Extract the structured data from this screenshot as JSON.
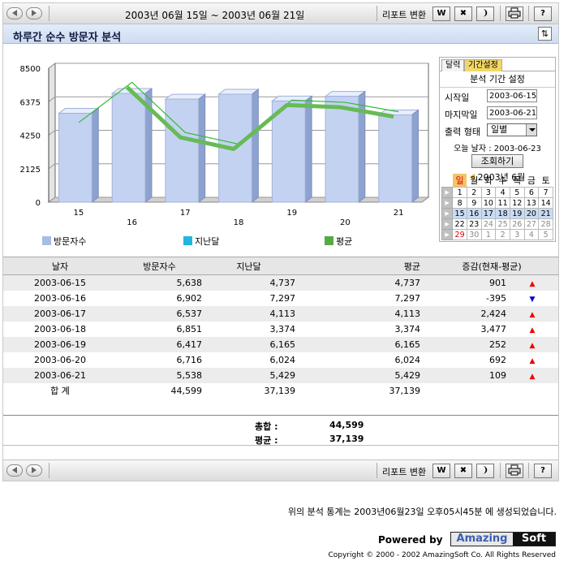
{
  "toolbar": {
    "date_range": "2003년 06월 15일 ~ 2003년 06월 21일",
    "report_label": "리포트 변환",
    "word_icon": "W",
    "excel_icon": "✖",
    "hwp_icon": "❩",
    "print_icon": "printer-icon",
    "help_icon": "?"
  },
  "title": "하루간 순수 방문자 분석",
  "chart_data": {
    "type": "bar",
    "categories": [
      "15",
      "16",
      "17",
      "18",
      "19",
      "20",
      "21"
    ],
    "series": [
      {
        "name": "방문자수",
        "type": "bar",
        "values": [
          5638,
          6902,
          6537,
          6851,
          6417,
          6716,
          5538
        ],
        "color": "#c4d2f2"
      },
      {
        "name": "지난달",
        "type": "line",
        "values": [
          4737,
          7297,
          4113,
          3374,
          6165,
          6024,
          5429
        ],
        "color": "#33bb33"
      },
      {
        "name": "평균",
        "type": "line",
        "values": [
          4737,
          7297,
          4113,
          3374,
          6165,
          6024,
          5429
        ],
        "color": "#66bb55"
      }
    ],
    "y_ticks": [
      "0",
      "2125",
      "4250",
      "6375",
      "8500"
    ],
    "ylim": [
      0,
      8500
    ],
    "grid": true,
    "legend": "bottom",
    "legend_colors": [
      "#a9bce6",
      "#22b5e0",
      "#55aa44"
    ]
  },
  "calendar": {
    "tab_calendar": "달력",
    "tab_period": "기간설정",
    "panel_title": "분석 기간 설정",
    "start_label": "시작일",
    "start_value": "2003-06-15",
    "end_label": "마지막일",
    "end_value": "2003-06-21",
    "format_label": "출력 형태",
    "format_value": "일별",
    "today_text": "오늘 날자 : 2003-06-23",
    "lookup_button": "조회하기",
    "month_label": "2003년 6월",
    "weekdays": [
      "일",
      "월",
      "화",
      "수",
      "목",
      "금",
      "토"
    ],
    "weeks": [
      [
        "1",
        "2",
        "3",
        "4",
        "5",
        "6",
        "7"
      ],
      [
        "8",
        "9",
        "10",
        "11",
        "12",
        "13",
        "14"
      ],
      [
        "15",
        "16",
        "17",
        "18",
        "19",
        "20",
        "21"
      ],
      [
        "22",
        "23",
        "24",
        "25",
        "26",
        "27",
        "28"
      ],
      [
        "29",
        "30",
        "1",
        "2",
        "3",
        "4",
        "5"
      ]
    ],
    "arrow": "▶"
  },
  "table": {
    "headers": [
      "날자",
      "방문자수",
      "지난달",
      "평균",
      "증감(현재-평균)"
    ],
    "rows": [
      {
        "date": "2003-06-15",
        "visitors": "5,638",
        "last_month": "4,737",
        "avg": "4,737",
        "diff": "901",
        "dir": "▲"
      },
      {
        "date": "2003-06-16",
        "visitors": "6,902",
        "last_month": "7,297",
        "avg": "7,297",
        "diff": "-395",
        "dir": "▼"
      },
      {
        "date": "2003-06-17",
        "visitors": "6,537",
        "last_month": "4,113",
        "avg": "4,113",
        "diff": "2,424",
        "dir": "▲"
      },
      {
        "date": "2003-06-18",
        "visitors": "6,851",
        "last_month": "3,374",
        "avg": "3,374",
        "diff": "3,477",
        "dir": "▲"
      },
      {
        "date": "2003-06-19",
        "visitors": "6,417",
        "last_month": "6,165",
        "avg": "6,165",
        "diff": "252",
        "dir": "▲"
      },
      {
        "date": "2003-06-20",
        "visitors": "6,716",
        "last_month": "6,024",
        "avg": "6,024",
        "diff": "692",
        "dir": "▲"
      },
      {
        "date": "2003-06-21",
        "visitors": "5,538",
        "last_month": "5,429",
        "avg": "5,429",
        "diff": "109",
        "dir": "▲"
      }
    ],
    "total": {
      "label": "합 계",
      "visitors": "44,599",
      "last_month": "37,139",
      "avg": "37,139"
    }
  },
  "summary": {
    "total_label": "총합 :",
    "total_value": "44,599",
    "avg_label": "평균 :",
    "avg_value": "37,139"
  },
  "footer": {
    "note": "위의 분석 통계는 2003년06월23일 오후05시45분 에 생성되었습니다.",
    "powered_by": "Powered by",
    "logo_left": "Amazing",
    "logo_right": "Soft",
    "copyright": "Copyright © 2000 - 2002 AmazingSoft Co. All Rights Reserved"
  }
}
